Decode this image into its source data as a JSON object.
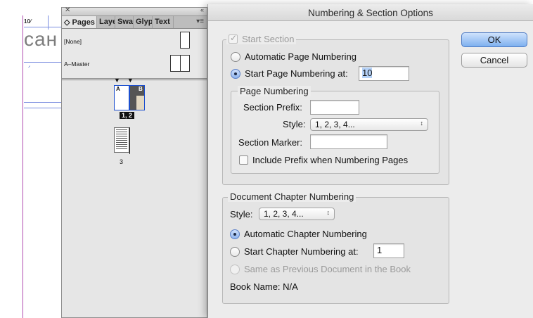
{
  "document": {
    "page_number_text": "10⁄",
    "heading_fragment": "сан"
  },
  "pages_panel": {
    "close_glyph": "✕",
    "collapse_glyph": "«",
    "menu_glyph": "▾≡",
    "tabs": [
      {
        "label": "◇ Pages"
      },
      {
        "label": "Laye"
      },
      {
        "label": "Swa"
      },
      {
        "label": "Glyp"
      },
      {
        "label": "Text"
      }
    ],
    "masters": [
      {
        "label": "[None]"
      },
      {
        "label": "A–Master"
      }
    ],
    "spread_markers": "▼▼",
    "spread_page_letters": [
      "A",
      "B"
    ],
    "spread_label": "1, 2",
    "page3_label": "3"
  },
  "dialog": {
    "title": "Numbering & Section Options",
    "start_section": {
      "label": "Start Section",
      "automatic_page_numbering": "Automatic Page Numbering",
      "start_page_numbering_at": "Start Page Numbering at:",
      "start_page_value": "10"
    },
    "page_numbering": {
      "legend": "Page Numbering",
      "section_prefix_label": "Section Prefix:",
      "section_prefix_value": "",
      "style_label": "Style:",
      "style_value": "1, 2, 3, 4...",
      "section_marker_label": "Section Marker:",
      "section_marker_value": "",
      "include_prefix_label": "Include Prefix when Numbering Pages"
    },
    "chapter_numbering": {
      "legend": "Document Chapter Numbering",
      "style_label": "Style:",
      "style_value": "1, 2, 3, 4...",
      "automatic_chapter_numbering": "Automatic Chapter Numbering",
      "start_chapter_numbering_at": "Start Chapter Numbering at:",
      "start_chapter_value": "1",
      "same_as_previous": "Same as Previous Document in the Book",
      "book_name": "Book Name: N/A"
    },
    "buttons": {
      "ok": "OK",
      "cancel": "Cancel"
    },
    "select_arrows_glyph": "↕"
  },
  "colors": {
    "accent_blue": "#7eb0ef",
    "guide_purple": "#b04cb0",
    "guide_blue": "#7a8de0"
  }
}
